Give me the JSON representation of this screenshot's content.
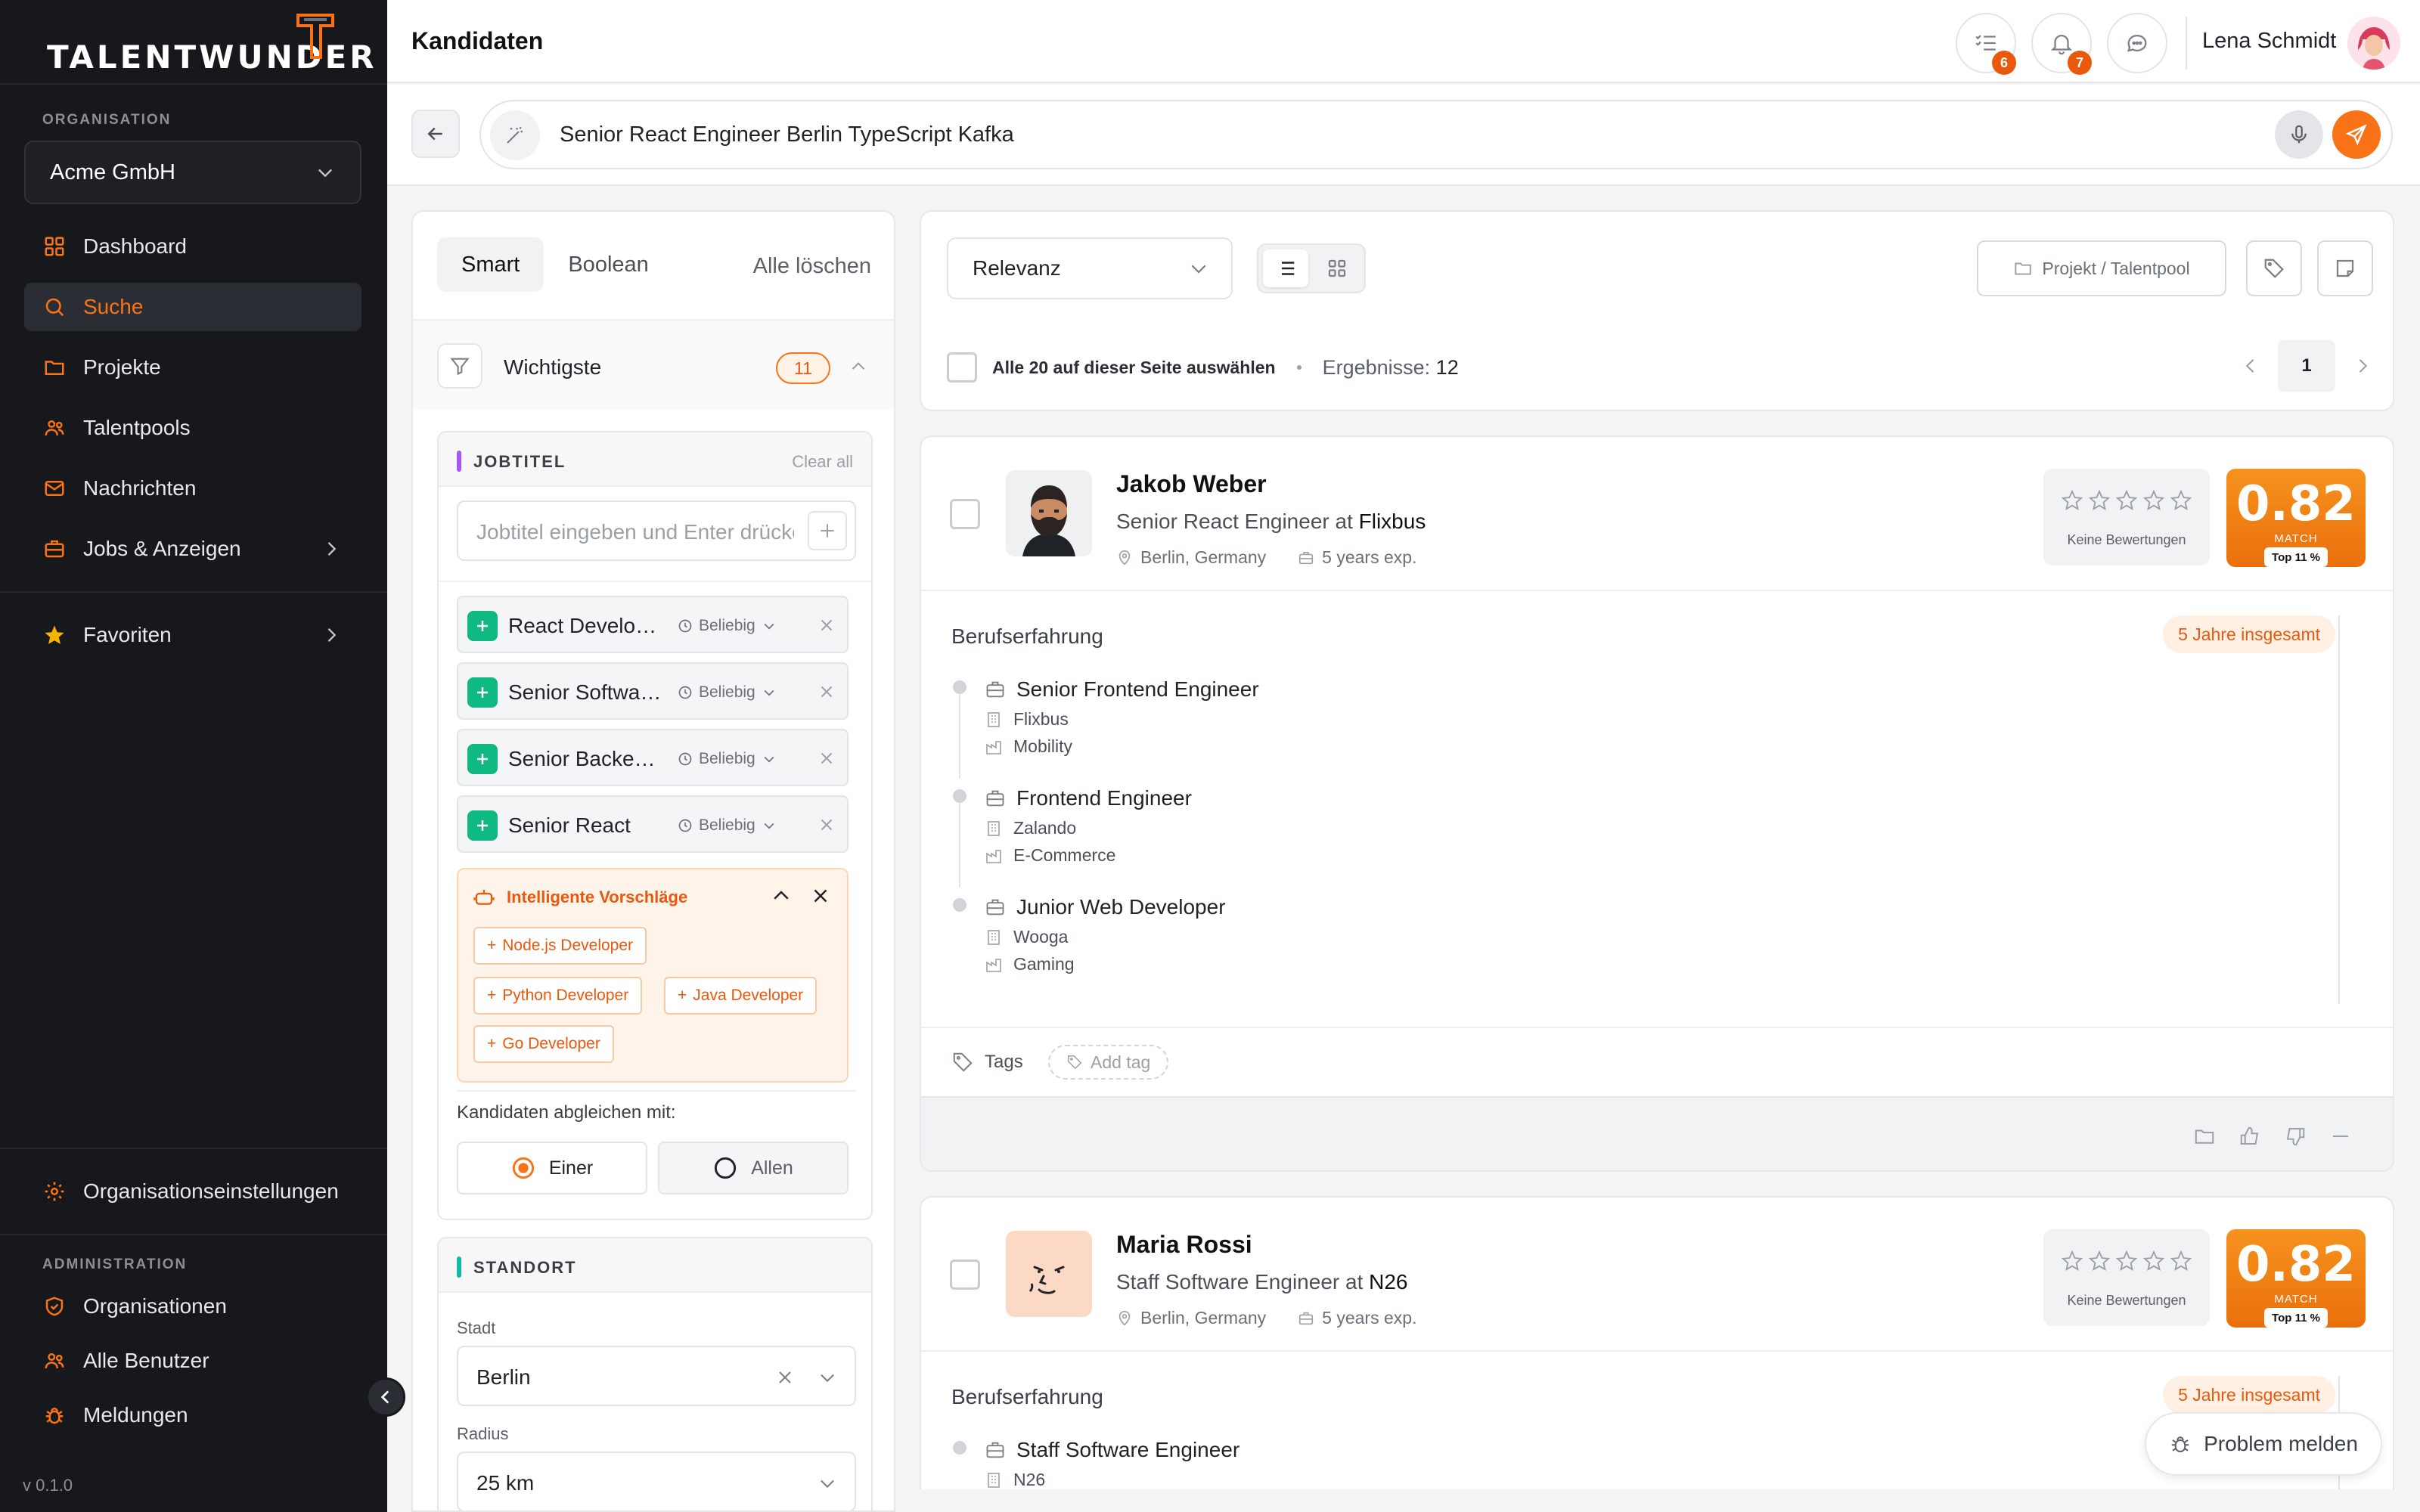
{
  "brand": {
    "name": "TALENTWUNDER",
    "accent": "#f97316"
  },
  "sidebar": {
    "org_section": "ORGANISATION",
    "org_name": "Acme GmbH",
    "items": [
      {
        "label": "Dashboard",
        "icon": "grid-icon"
      },
      {
        "label": "Suche",
        "icon": "search-icon",
        "active": true
      },
      {
        "label": "Projekte",
        "icon": "folder-icon"
      },
      {
        "label": "Talentpools",
        "icon": "users-icon"
      },
      {
        "label": "Nachrichten",
        "icon": "mail-icon"
      },
      {
        "label": "Jobs & Anzeigen",
        "icon": "briefcase-icon"
      }
    ],
    "favorites": "Favoriten",
    "org_settings": "Organisationseinstellungen",
    "admin_section": "ADMINISTRATION",
    "admin_items": [
      {
        "label": "Organisationen",
        "icon": "shield-icon"
      },
      {
        "label": "Alle Benutzer",
        "icon": "users-icon"
      },
      {
        "label": "Meldungen",
        "icon": "bug-icon"
      }
    ],
    "version": "v 0.1.0"
  },
  "header": {
    "title": "Kandidaten",
    "tasks_badge": "6",
    "notifications_badge": "7",
    "user_name": "Lena Schmidt"
  },
  "search": {
    "query": "Senior React Engineer Berlin TypeScript Kafka"
  },
  "filters": {
    "tabs": [
      "Smart",
      "Boolean"
    ],
    "clear_all": "Alle löschen",
    "important_label": "Wichtigste",
    "important_count": "11",
    "jobtitle": {
      "title": "JOBTITEL",
      "clear": "Clear all",
      "placeholder": "Jobtitel eingeben und Enter drücken",
      "items": [
        {
          "name": "React Developer",
          "when": "Beliebig"
        },
        {
          "name": "Senior Software Engineer",
          "when": "Beliebig"
        },
        {
          "name": "Senior Backend Engineer",
          "when": "Beliebig"
        },
        {
          "name": "Senior React",
          "when": "Beliebig"
        }
      ],
      "suggest_title": "Intelligente Vorschläge",
      "suggestions": [
        "Node.js Developer",
        "Python Developer",
        "Java Developer",
        "Go Developer"
      ],
      "match_label": "Kandidaten abgleichen mit:",
      "match_one": "Einer",
      "match_all": "Allen"
    },
    "location": {
      "title": "STANDORT",
      "city_label": "Stadt",
      "city": "Berlin",
      "radius_label": "Radius",
      "radius": "25 km"
    }
  },
  "results": {
    "sort": "Relevanz",
    "project_button": "Projekt / Talentpool",
    "select_all": "Alle 20 auf dieser Seite auswählen",
    "results_label": "Ergebnisse:",
    "results_count": "12",
    "page": "1"
  },
  "candidates": [
    {
      "name": "Jakob Weber",
      "role": "Senior React Engineer at",
      "company": "Flixbus",
      "location": "Berlin, Germany",
      "experience": "5 years exp.",
      "rating_label": "Keine Bewertungen",
      "score": "0.82",
      "score_label": "MATCH",
      "score_rank": "Top 11 %",
      "exp_title": "Berufserfahrung",
      "exp_total": "5 Jahre insgesamt",
      "jobs": [
        {
          "title": "Senior Frontend Engineer",
          "company": "Flixbus",
          "industry": "Mobility"
        },
        {
          "title": "Frontend Engineer",
          "company": "Zalando",
          "industry": "E-Commerce"
        },
        {
          "title": "Junior Web Developer",
          "company": "Wooga",
          "industry": "Gaming"
        }
      ],
      "tags_label": "Tags",
      "add_tag": "Add tag"
    },
    {
      "name": "Maria Rossi",
      "role": "Staff Software Engineer at",
      "company": "N26",
      "location": "Berlin, Germany",
      "experience": "5 years exp.",
      "rating_label": "Keine Bewertungen",
      "score": "0.82",
      "score_label": "MATCH",
      "score_rank": "Top 11 %",
      "exp_title": "Berufserfahrung",
      "exp_total": "5 Jahre insgesamt",
      "jobs": [
        {
          "title": "Staff Software Engineer",
          "company": "N26"
        }
      ]
    }
  ],
  "problem_button": "Problem melden"
}
